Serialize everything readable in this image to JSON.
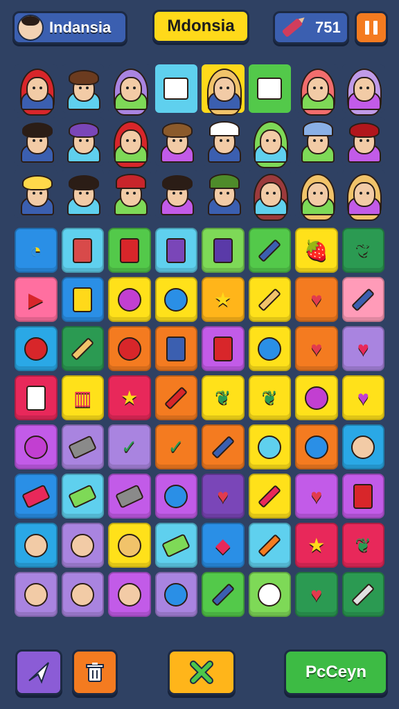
{
  "header": {
    "player_name": "Indansia",
    "title": "Mdonsia",
    "score": "751"
  },
  "colors": {
    "background": "#2f4163",
    "title_bg": "#ffd91a",
    "pause_bg": "#f47b20",
    "confirm_bg": "#3dbb44"
  },
  "characters": [
    {
      "type": "hijab",
      "color": "#d8262a",
      "bg": "#2f4163"
    },
    {
      "type": "boy",
      "color": "#6b3b1f",
      "bg": "#2f4163"
    },
    {
      "type": "hijab",
      "color": "#a984e0",
      "bg": "#2f4163"
    },
    {
      "type": "item",
      "icon": "gold-card-icon",
      "bg": "#5fd0ee"
    },
    {
      "type": "hijab",
      "color": "#f1c36a",
      "bg": "#ffd91a"
    },
    {
      "type": "item",
      "icon": "flag-card-icon",
      "bg": "#53c94a"
    },
    {
      "type": "hijab",
      "color": "#f26d6d",
      "bg": "#2f4163"
    },
    {
      "type": "hijab",
      "color": "#c09be8",
      "bg": "#2f4163"
    },
    {
      "type": "girl",
      "color": "#2b1d16",
      "bg": "#2f4163"
    },
    {
      "type": "boy",
      "color": "#7a46b8",
      "bg": "#2f4163"
    },
    {
      "type": "hijab",
      "color": "#d8262a",
      "bg": "#2f4163"
    },
    {
      "type": "boy",
      "color": "#8b5a2b",
      "bg": "#2f4163"
    },
    {
      "type": "cap",
      "color": "#ffffff",
      "bg": "#2f4163"
    },
    {
      "type": "hijab",
      "color": "#7ed957",
      "bg": "#2f4163"
    },
    {
      "type": "hat",
      "color": "#8ab0e6",
      "bg": "#2f4163"
    },
    {
      "type": "girl",
      "color": "#b1161c",
      "bg": "#2f4163"
    },
    {
      "type": "boy",
      "color": "#ffd84a",
      "bg": "#2f4163"
    },
    {
      "type": "boy",
      "color": "#2b1d16",
      "bg": "#2f4163"
    },
    {
      "type": "hat",
      "color": "#c8252b",
      "bg": "#2f4163"
    },
    {
      "type": "boy",
      "color": "#2b1d16",
      "bg": "#2f4163"
    },
    {
      "type": "hat",
      "color": "#4e8b2a",
      "bg": "#2f4163"
    },
    {
      "type": "hijab",
      "color": "#9c3a3c",
      "bg": "#2f4163"
    },
    {
      "type": "hijab",
      "color": "#f1c36a",
      "bg": "#2f4163"
    },
    {
      "type": "hijab",
      "color": "#f1c36a",
      "bg": "#2f4163"
    }
  ],
  "items": [
    {
      "name": "chart-icon",
      "bg": "#2a8fe6",
      "glyph": "◔",
      "shape": "glyph"
    },
    {
      "name": "phone-card-icon",
      "bg": "#5fd0ee",
      "shape": "card",
      "color": "#d84a4a"
    },
    {
      "name": "red-card-icon",
      "bg": "#53c94a",
      "shape": "card",
      "color": "#d8262a"
    },
    {
      "name": "purple-card-icon",
      "bg": "#5fd0ee",
      "shape": "card",
      "color": "#7a46b8"
    },
    {
      "name": "star-card-icon",
      "bg": "#7ed957",
      "shape": "card",
      "color": "#5a3aa8"
    },
    {
      "name": "pen-icon",
      "bg": "#53c94a",
      "shape": "pencil",
      "color": "#3b5fb0"
    },
    {
      "name": "strawberry-icon",
      "bg": "#ffe11a",
      "glyph": "🍓",
      "shape": "glyph"
    },
    {
      "name": "feather-icon",
      "bg": "#2b9a52",
      "glyph": "❦",
      "shape": "glyph"
    },
    {
      "name": "play-card-icon",
      "bg": "#ff6fa0",
      "glyph": "▶",
      "shape": "glyph"
    },
    {
      "name": "screen-card-icon",
      "bg": "#2a8fe6",
      "shape": "card",
      "color": "#ffd91a"
    },
    {
      "name": "grape-icon",
      "bg": "#ffe11a",
      "shape": "circle",
      "color": "#c23fd1"
    },
    {
      "name": "speech-bubble-icon",
      "bg": "#ffe11a",
      "shape": "circle",
      "color": "#2a8fe6"
    },
    {
      "name": "star-icon",
      "bg": "#ffb51a",
      "glyph": "★",
      "shape": "glyph"
    },
    {
      "name": "pencil-icon",
      "bg": "#ffe11a",
      "shape": "pencil",
      "color": "#f1c36a"
    },
    {
      "name": "heart-icon",
      "bg": "#f47b20",
      "glyph": "♥",
      "shape": "glyph"
    },
    {
      "name": "rocket-icon",
      "bg": "#ff9bb8",
      "shape": "pencil",
      "color": "#3b5fb0"
    },
    {
      "name": "apple-icon",
      "bg": "#2aa8e6",
      "shape": "circle",
      "color": "#d8262a"
    },
    {
      "name": "wand-icon",
      "bg": "#2b9a52",
      "shape": "pencil",
      "color": "#f1c36a"
    },
    {
      "name": "cherry-icon",
      "bg": "#f47b20",
      "shape": "circle",
      "color": "#d8262a"
    },
    {
      "name": "star-card-icon",
      "bg": "#f47b20",
      "shape": "card",
      "color": "#3b5fb0"
    },
    {
      "name": "phone-icon",
      "bg": "#c25be8",
      "shape": "card",
      "color": "#d8262a"
    },
    {
      "name": "magnifier-icon",
      "bg": "#ffe11a",
      "shape": "circle",
      "color": "#2a8fe6"
    },
    {
      "name": "heart-icon",
      "bg": "#f47b20",
      "glyph": "♥",
      "shape": "glyph"
    },
    {
      "name": "heart-gem-icon",
      "bg": "#a984e0",
      "glyph": "♥",
      "shape": "glyph"
    },
    {
      "name": "flag-card-icon",
      "bg": "#e8285a",
      "shape": "card",
      "color": "#ffffff"
    },
    {
      "name": "bars-icon",
      "bg": "#ffe11a",
      "glyph": "▥",
      "shape": "glyph"
    },
    {
      "name": "star-icon",
      "bg": "#e8285a",
      "glyph": "★",
      "shape": "glyph"
    },
    {
      "name": "pen-icon",
      "bg": "#f47b20",
      "shape": "pencil",
      "color": "#d8262a"
    },
    {
      "name": "leaf-icon",
      "bg": "#ffe11a",
      "glyph": "❦",
      "shape": "glyph"
    },
    {
      "name": "leaf-icon",
      "bg": "#ffe11a",
      "glyph": "❦",
      "shape": "glyph"
    },
    {
      "name": "gem-icon",
      "bg": "#ffe11a",
      "shape": "circle",
      "color": "#c23fd1"
    },
    {
      "name": "heart-icon",
      "bg": "#ffe11a",
      "glyph": "♥",
      "shape": "glyph"
    },
    {
      "name": "apple-icon",
      "bg": "#c25be8",
      "shape": "circle",
      "color": "#c23fd1"
    },
    {
      "name": "eraser-icon",
      "bg": "#a984e0",
      "shape": "eraser",
      "color": "#8a8a8a"
    },
    {
      "name": "check-icon",
      "bg": "#a984e0",
      "glyph": "✓",
      "shape": "glyph"
    },
    {
      "name": "check-icon",
      "bg": "#f47b20",
      "glyph": "✓",
      "shape": "glyph"
    },
    {
      "name": "brush-icon",
      "bg": "#f47b20",
      "shape": "pencil",
      "color": "#3b5fb0"
    },
    {
      "name": "magnifier-icon",
      "bg": "#ffe11a",
      "shape": "circle",
      "color": "#5fd0ee"
    },
    {
      "name": "magnifier-icon",
      "bg": "#f47b20",
      "shape": "circle",
      "color": "#2a8fe6"
    },
    {
      "name": "boy-portrait-icon",
      "bg": "#2aa8e6",
      "shape": "circle",
      "color": "#f2cba6"
    },
    {
      "name": "tools-icon",
      "bg": "#2a8fe6",
      "shape": "eraser",
      "color": "#e8285a"
    },
    {
      "name": "eraser-icon",
      "bg": "#5fd0ee",
      "shape": "eraser",
      "color": "#7ed957"
    },
    {
      "name": "eraser-icon",
      "bg": "#c25be8",
      "shape": "eraser",
      "color": "#8a8a8a"
    },
    {
      "name": "magnifier-icon",
      "bg": "#c25be8",
      "shape": "circle",
      "color": "#2a8fe6"
    },
    {
      "name": "heart-icon",
      "bg": "#7a46b8",
      "glyph": "♥",
      "shape": "glyph"
    },
    {
      "name": "pen-icon",
      "bg": "#ffe11a",
      "shape": "pencil",
      "color": "#e8285a"
    },
    {
      "name": "heart-icon",
      "bg": "#c25be8",
      "glyph": "♥",
      "shape": "glyph"
    },
    {
      "name": "card-icon",
      "bg": "#c25be8",
      "shape": "card",
      "color": "#d8262a"
    },
    {
      "name": "boy-portrait-icon",
      "bg": "#2aa8e6",
      "shape": "circle",
      "color": "#f2cba6"
    },
    {
      "name": "girl-portrait-icon",
      "bg": "#a984e0",
      "shape": "circle",
      "color": "#f2cba6"
    },
    {
      "name": "hijab-portrait-icon",
      "bg": "#ffe11a",
      "shape": "circle",
      "color": "#f1c36a"
    },
    {
      "name": "eraser-icon",
      "bg": "#5fd0ee",
      "shape": "eraser",
      "color": "#7ed957"
    },
    {
      "name": "gem-icon",
      "bg": "#2a8fe6",
      "glyph": "◆",
      "shape": "glyph"
    },
    {
      "name": "feather-icon",
      "bg": "#5fd0ee",
      "shape": "pencil",
      "color": "#f47b20"
    },
    {
      "name": "star-icon",
      "bg": "#e8285a",
      "glyph": "★",
      "shape": "glyph"
    },
    {
      "name": "leaf-icon",
      "bg": "#e8285a",
      "glyph": "❦",
      "shape": "glyph"
    },
    {
      "name": "girl-portrait-icon",
      "bg": "#a984e0",
      "shape": "circle",
      "color": "#f2cba6"
    },
    {
      "name": "boy-hat-portrait-icon",
      "bg": "#a984e0",
      "shape": "circle",
      "color": "#f2cba6"
    },
    {
      "name": "boy-hat-portrait-icon",
      "bg": "#c25be8",
      "shape": "circle",
      "color": "#f2cba6"
    },
    {
      "name": "magnifier-icon",
      "bg": "#a984e0",
      "shape": "circle",
      "color": "#2a8fe6"
    },
    {
      "name": "brush-icon",
      "bg": "#53c94a",
      "shape": "pencil",
      "color": "#3b5fb0"
    },
    {
      "name": "ball-icon",
      "bg": "#7ed957",
      "shape": "circle",
      "color": "#ffffff"
    },
    {
      "name": "heart-icon",
      "bg": "#2b9a52",
      "glyph": "♥",
      "shape": "glyph"
    },
    {
      "name": "brush-icon",
      "bg": "#2b9a52",
      "shape": "pencil",
      "color": "#e0e0e0"
    }
  ],
  "buttons": {
    "confirm_label": "PcCeyn"
  }
}
